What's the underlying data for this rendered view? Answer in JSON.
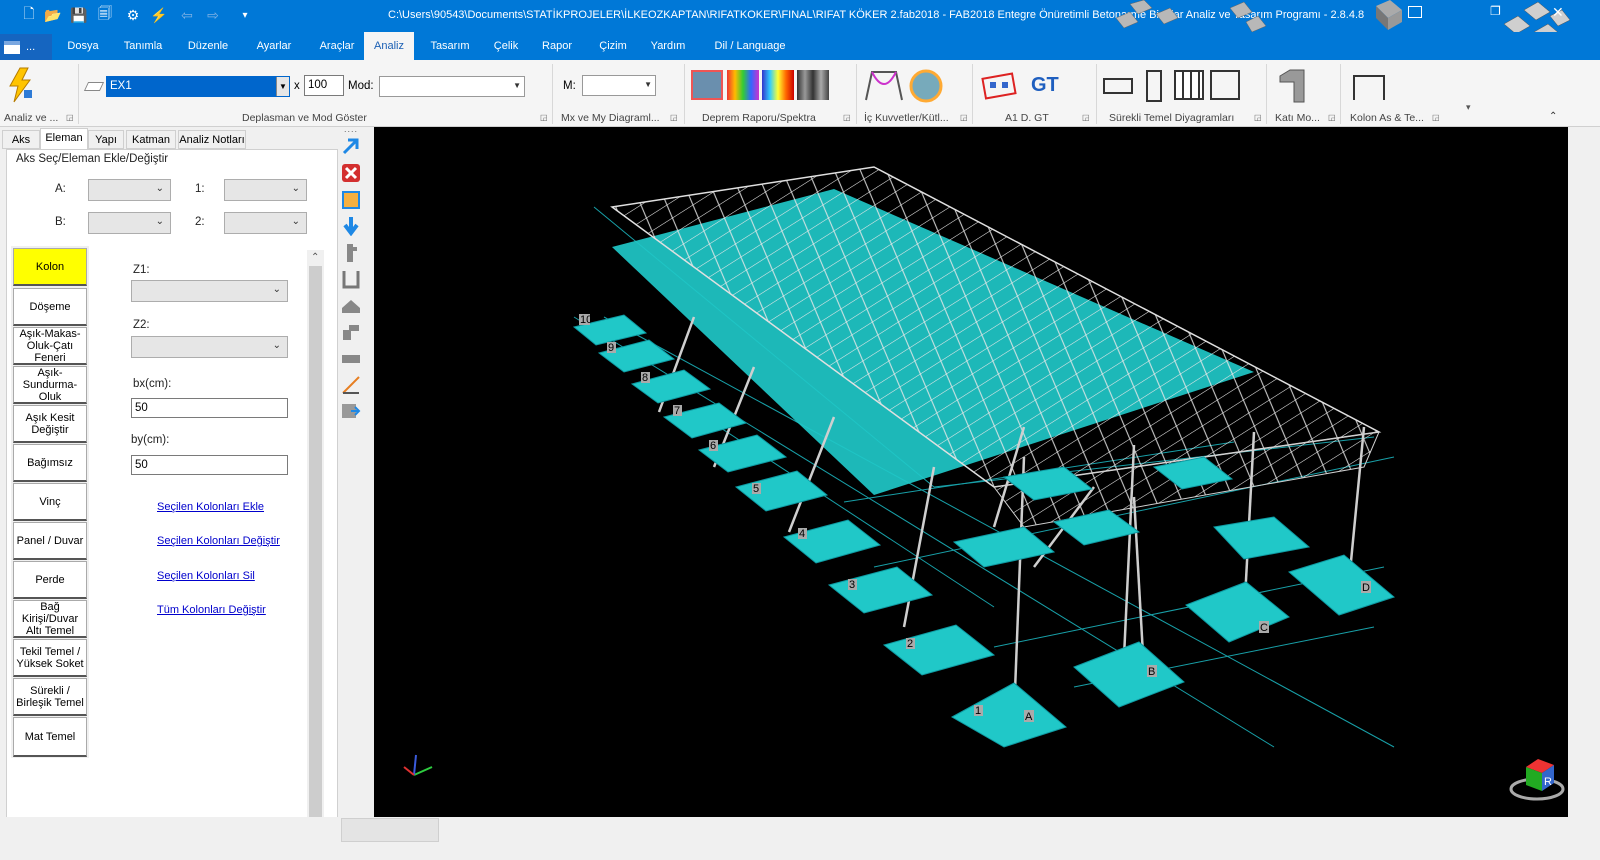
{
  "window": {
    "title": "C:\\Users\\90543\\Documents\\STATİKPROJELER\\İLKEOZKAPTAN\\RIFATKOKER\\FINAL\\RIFAT KÖKER 2.fab2018 - FAB2018 Entegre Önüretimli Betonarme Binalar Analiz ve Tasarım Programı - 2.8.4.8"
  },
  "menu": {
    "app_btn": "...",
    "items": [
      "Dosya",
      "Tanımla",
      "Düzenle",
      "Ayarlar",
      "Araçlar",
      "Analiz",
      "Tasarım",
      "Çelik",
      "Rapor",
      "Çizim",
      "Yardım",
      "Dil / Language"
    ],
    "active": "Analiz"
  },
  "ribbon": {
    "load_combo": "EX1",
    "scale_prefix": "x",
    "scale_value": "100",
    "mod_label": "Mod:",
    "mod_value": "",
    "m_label": "M:",
    "m_value": "",
    "groups": {
      "analysis": "Analiz ve ...",
      "disp": "Deplasman ve Mod  Göster",
      "mx": "Mx ve My Diagraml...",
      "deprem": "Deprem Raporu/Spektra",
      "ic": "İç Kuvvetler/Kütl...",
      "a1": "A1 D. GT",
      "surekli": "Sürekli Temel Diyagramları",
      "kati": "Katı Mo...",
      "kolon": "Kolon As & Te..."
    },
    "gt_label": "GT"
  },
  "left_tabs": [
    "Aks",
    "Eleman",
    "Yapı",
    "Katman",
    "Analiz Notları"
  ],
  "left_tab_active": "Eleman",
  "aks_group": {
    "title": "Aks Seç/Eleman Ekle/Değiştir",
    "a": "A:",
    "b": "B:",
    "one": "1:",
    "two": "2:"
  },
  "element_buttons": [
    "Kolon",
    "Döşeme",
    "Aşık-Makas-Oluk-Çatı Feneri",
    "Aşık-Sundurma-Oluk",
    "Aşık Kesit Değiştir",
    "Bağımsız",
    "Vinç",
    "Panel / Duvar",
    "Perde",
    "Bağ Kirişi/Duvar Altı Temel",
    "Tekil Temel / Yüksek Soket",
    "Sürekli / Birleşik Temel",
    "Mat Temel"
  ],
  "column_form": {
    "z1": "Z1:",
    "z2": "Z2:",
    "bx_label": "bx(cm):",
    "bx": "50",
    "by_label": "by(cm):",
    "by": "50"
  },
  "links": [
    "Seçilen Kolonları Ekle",
    "Seçilen Kolonları Değiştir",
    "Seçilen Kolonları Sil",
    "Tüm Kolonları Değiştir"
  ],
  "viewport": {
    "axis_numbers": [
      "1",
      "2",
      "3",
      "4",
      "5",
      "6",
      "7",
      "8",
      "9",
      "10"
    ],
    "axis_letters": [
      "A",
      "B",
      "C",
      "D"
    ],
    "cube_letter": "R"
  },
  "colors": {
    "title_bg": "#0078d7",
    "cyan": "#20c8c8",
    "viewport_bg": "#000000",
    "selected": "#ffff00"
  }
}
